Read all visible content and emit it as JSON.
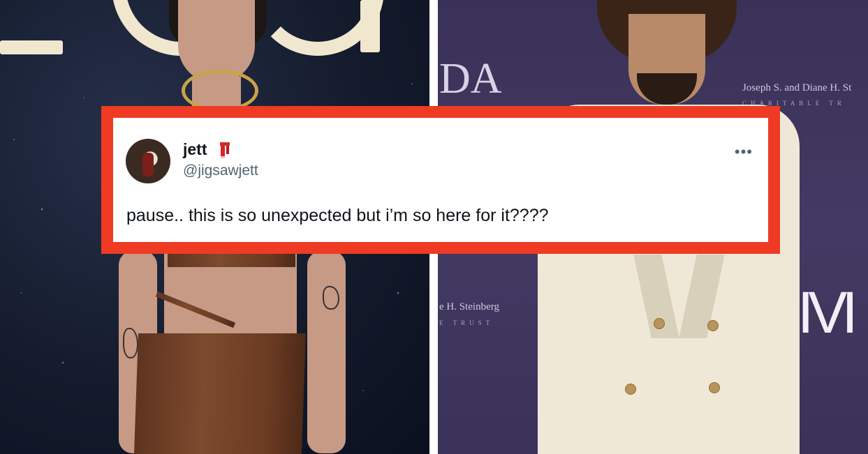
{
  "tweet": {
    "display_name": "jett",
    "handle": "@jigsawjett",
    "text": "pause.. this is so unexpected but i’m so here for it????",
    "more_icon": "more-horizontal-icon",
    "name_emoji_icon": "scarf-icon",
    "accent_frame_color": "#ef3a24"
  },
  "backdrop_right": {
    "sponsor_line_1": "Joseph S. and Diane H. St",
    "sponsor_line_2": "CHARITABLE TR",
    "logo_letters": "DA",
    "sponsor_line_3": "e H. Steinberg",
    "sponsor_line_4": "E TRUST",
    "logo_letters_2": "IVI"
  }
}
